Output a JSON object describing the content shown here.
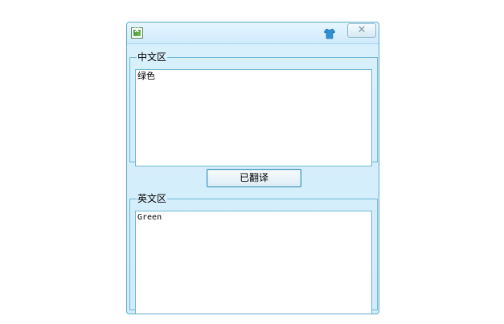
{
  "window": {
    "app_icon": "excel-x-icon",
    "skin_icon": "shirt-icon",
    "close_label": "✕"
  },
  "chinese_area": {
    "legend": "中文区",
    "text": "绿色"
  },
  "translate_button": {
    "label": "已翻译"
  },
  "english_area": {
    "legend": "英文区",
    "text": "Green"
  },
  "colors": {
    "border": "#6fb7d3",
    "window_bg": "#d6eefb",
    "skin_icon": "#2f8fd0"
  }
}
